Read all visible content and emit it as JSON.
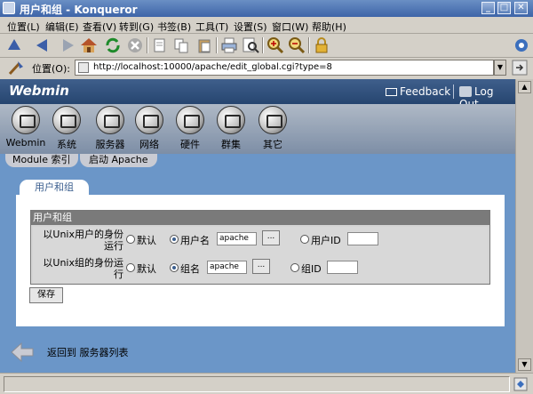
{
  "window": {
    "title": "用户和组 - Konqueror"
  },
  "menu": [
    "位置(L)",
    "编辑(E)",
    "查看(V)",
    "转到(G)",
    "书签(B)",
    "工具(T)",
    "设置(S)",
    "窗口(W)",
    "帮助(H)"
  ],
  "location": {
    "label": "位置(O):",
    "url": "http://localhost:10000/apache/edit_global.cgi?type=8"
  },
  "header": {
    "logo": "Webmin",
    "feedback": "Feedback",
    "logout": "Log Out"
  },
  "categories": [
    {
      "label": "Webmin"
    },
    {
      "label": "系统"
    },
    {
      "label": "服务器"
    },
    {
      "label": "网络"
    },
    {
      "label": "硬件"
    },
    {
      "label": "群集"
    },
    {
      "label": "其它"
    }
  ],
  "tabs": {
    "module_index": "Module 索引",
    "start": "启动 Apache"
  },
  "page_tab": "用户和组",
  "form": {
    "header": "用户和组",
    "user_row": {
      "label": "以Unix用户的身份运行",
      "default_label": "默认",
      "name_label": "用户名",
      "name_value": "apache",
      "browse": "...",
      "id_label": "用户ID",
      "id_value": "",
      "selected": "name"
    },
    "group_row": {
      "label": "以Unix组的身份运行",
      "default_label": "默认",
      "name_label": "组名",
      "name_value": "apache",
      "browse": "...",
      "id_label": "组ID",
      "id_value": "",
      "selected": "name"
    },
    "save_label": "保存"
  },
  "back_link": "返回到 服务器列表",
  "colors": {
    "content_bg": "#6b96c8",
    "header_bg": "#26456f",
    "accent": "#3b5e8e"
  }
}
